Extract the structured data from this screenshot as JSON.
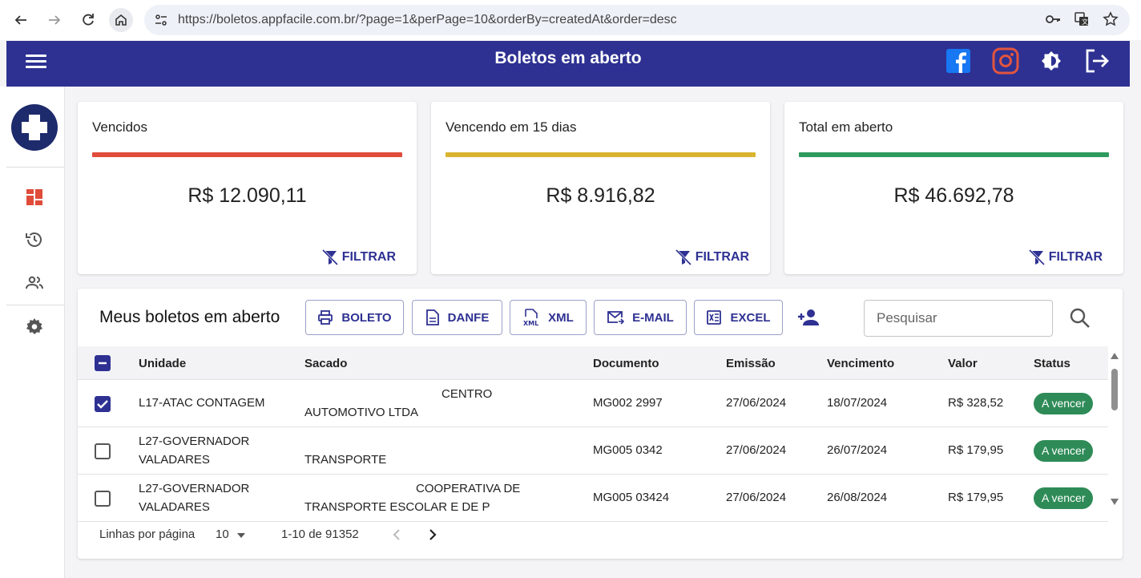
{
  "browser": {
    "url": "https://boletos.appfacile.com.br/?page=1&perPage=10&orderBy=createdAt&order=desc"
  },
  "app_bar": {
    "title": "Boletos em aberto",
    "bg_color": "#2e3192"
  },
  "summary": [
    {
      "label": "Vencidos",
      "value": "R$ 12.090,11",
      "color": "#e04b3a",
      "filter_label": "FILTRAR"
    },
    {
      "label": "Vencendo em 15 dias",
      "value": "R$ 8.916,82",
      "color": "#d9b52f",
      "filter_label": "FILTRAR"
    },
    {
      "label": "Total em aberto",
      "value": "R$ 46.692,78",
      "color": "#2e9a5e",
      "filter_label": "FILTRAR"
    }
  ],
  "table": {
    "title": "Meus boletos em aberto",
    "buttons": [
      "BOLETO",
      "DANFE",
      "XML",
      "E-MAIL",
      "EXCEL"
    ],
    "search_placeholder": "Pesquisar",
    "columns": [
      "Unidade",
      "Sacado",
      "Documento",
      "Emissão",
      "Vencimento",
      "Valor",
      "Status"
    ],
    "rows": [
      {
        "checked": true,
        "unidade": "L17-ATAC CONTAGEM",
        "sacado_1": "CENTRO",
        "sacado_2": "AUTOMOTIVO LTDA",
        "documento": "MG002 2997",
        "emissao": "27/06/2024",
        "vencimento": "18/07/2024",
        "valor": "R$ 328,52",
        "status": "A vencer"
      },
      {
        "checked": false,
        "unidade_1": "L27-GOVERNADOR",
        "unidade_2": "VALADARES",
        "sacado_1": "",
        "sacado_2": "TRANSPORTE",
        "documento": "MG005 0342",
        "emissao": "27/06/2024",
        "vencimento": "26/07/2024",
        "valor": "R$ 179,95",
        "status": "A vencer"
      },
      {
        "checked": false,
        "unidade_1": "L27-GOVERNADOR",
        "unidade_2": "VALADARES",
        "sacado_1": "COOPERATIVA DE",
        "sacado_2": "TRANSPORTE ESCOLAR E DE P",
        "documento": "MG005 03424",
        "emissao": "27/06/2024",
        "vencimento": "26/08/2024",
        "valor": "R$ 179,95",
        "status": "A vencer"
      }
    ],
    "pagination": {
      "rows_label": "Linhas por página",
      "per_page": "10",
      "range": "1-10 de 91352"
    }
  }
}
